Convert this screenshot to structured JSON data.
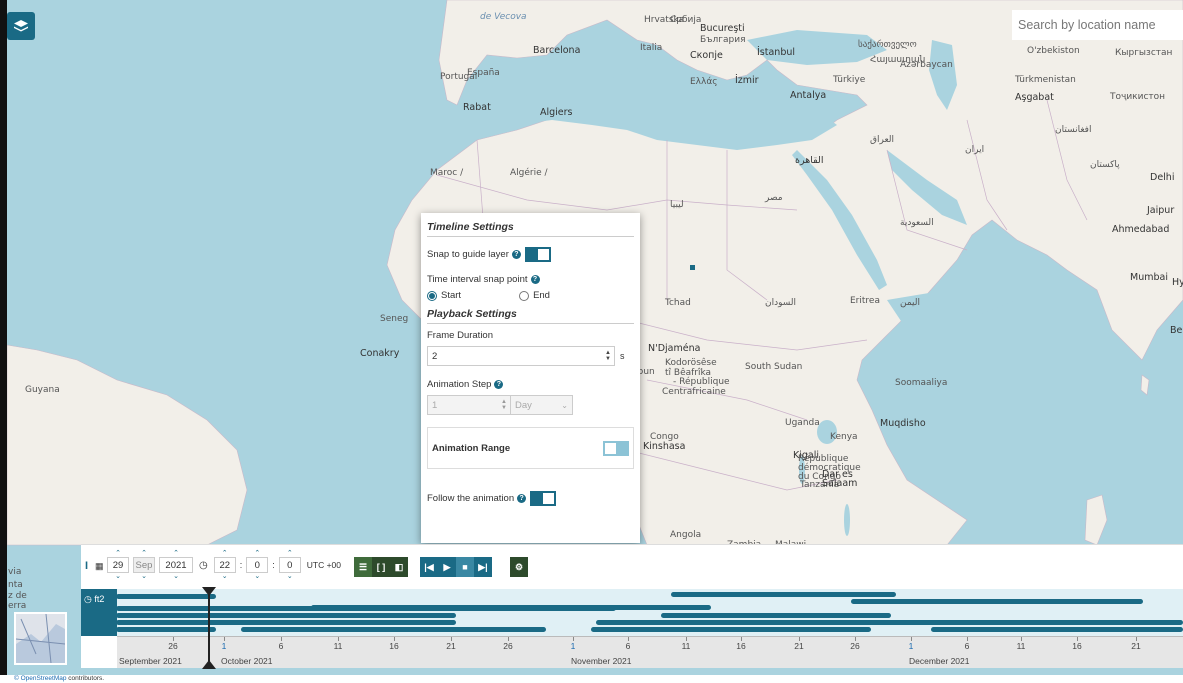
{
  "search": {
    "placeholder": "Search by location name"
  },
  "map_labels": [
    {
      "text": "Barcelona",
      "cls": "dark"
    },
    {
      "text": "España",
      "cls": ""
    },
    {
      "text": "Portugal",
      "cls": ""
    },
    {
      "text": "Italia",
      "cls": ""
    },
    {
      "text": "Hrvatska",
      "cls": ""
    },
    {
      "text": "Србија",
      "cls": ""
    },
    {
      "text": "Bucureşti",
      "cls": "dark"
    },
    {
      "text": "България",
      "cls": ""
    },
    {
      "text": "Скопje",
      "cls": "dark"
    },
    {
      "text": "İstanbul",
      "cls": "dark"
    },
    {
      "text": "Ελλάς",
      "cls": ""
    },
    {
      "text": "İzmir",
      "cls": "dark"
    },
    {
      "text": "Türkiye",
      "cls": ""
    },
    {
      "text": "Antalya",
      "cls": "dark"
    },
    {
      "text": "საქართველო",
      "cls": ""
    },
    {
      "text": "Հայաստան",
      "cls": ""
    },
    {
      "text": "Azərbaycan",
      "cls": ""
    },
    {
      "text": "O'zbekiston",
      "cls": ""
    },
    {
      "text": "Кыргызстан",
      "cls": ""
    },
    {
      "text": "Türkmenistan",
      "cls": ""
    },
    {
      "text": "Aşgabat",
      "cls": "dark"
    },
    {
      "text": "Тоҷикистон",
      "cls": ""
    },
    {
      "text": "Rabat",
      "cls": "dark"
    },
    {
      "text": "Algiers",
      "cls": "dark"
    },
    {
      "text": "Maroc /",
      "cls": ""
    },
    {
      "text": "Algérie /",
      "cls": ""
    },
    {
      "text": "ليبيا",
      "cls": ""
    },
    {
      "text": "مصر",
      "cls": ""
    },
    {
      "text": "القاهرة",
      "cls": "dark"
    },
    {
      "text": "العراق",
      "cls": ""
    },
    {
      "text": "ایران",
      "cls": ""
    },
    {
      "text": "افغانستان",
      "cls": ""
    },
    {
      "text": "پاکستان",
      "cls": ""
    },
    {
      "text": "Delhi",
      "cls": "dark"
    },
    {
      "text": "Jaipur",
      "cls": "dark"
    },
    {
      "text": "السعودية",
      "cls": ""
    },
    {
      "text": "Ahmedabad",
      "cls": "dark"
    },
    {
      "text": "Mumbai",
      "cls": "dark"
    },
    {
      "text": "Hyde",
      "cls": "dark"
    },
    {
      "text": "Benga",
      "cls": "dark"
    },
    {
      "text": "Tchad",
      "cls": ""
    },
    {
      "text": "السودان",
      "cls": ""
    },
    {
      "text": "Eritrea",
      "cls": ""
    },
    {
      "text": "اليمن",
      "cls": ""
    },
    {
      "text": "N'Djaména",
      "cls": "dark"
    },
    {
      "text": "Kodorösêse",
      "cls": ""
    },
    {
      "text": "tî Bêafrîka",
      "cls": ""
    },
    {
      "text": "- République",
      "cls": ""
    },
    {
      "text": "Centrafricaine",
      "cls": ""
    },
    {
      "text": "South Sudan",
      "cls": ""
    },
    {
      "text": "Soomaaliya",
      "cls": ""
    },
    {
      "text": "Muqdisho",
      "cls": "dark"
    },
    {
      "text": "Kenya",
      "cls": ""
    },
    {
      "text": "Uganda",
      "cls": ""
    },
    {
      "text": "Kigali",
      "cls": "dark"
    },
    {
      "text": "République",
      "cls": ""
    },
    {
      "text": "démocratique",
      "cls": ""
    },
    {
      "text": "du Congo",
      "cls": ""
    },
    {
      "text": "Kinshasa",
      "cls": "dark"
    },
    {
      "text": "Congo",
      "cls": ""
    },
    {
      "text": "Tanzania",
      "cls": ""
    },
    {
      "text": "Dar es",
      "cls": "dark"
    },
    {
      "text": "Salaam",
      "cls": "dark"
    },
    {
      "text": "Angola",
      "cls": ""
    },
    {
      "text": "Zambia",
      "cls": ""
    },
    {
      "text": "Malawi",
      "cls": ""
    },
    {
      "text": "Guyana",
      "cls": ""
    },
    {
      "text": "Conakry",
      "cls": "dark"
    },
    {
      "text": "Seneg",
      "cls": ""
    },
    {
      "text": "meroun",
      "cls": ""
    },
    {
      "text": "via",
      "cls": ""
    },
    {
      "text": "nta",
      "cls": ""
    },
    {
      "text": "z de",
      "cls": ""
    },
    {
      "text": "erra",
      "cls": ""
    },
    {
      "text": "de Vecova",
      "cls": "water"
    }
  ],
  "settings": {
    "timeline_title": "Timeline Settings",
    "snap_label": "Snap to guide layer",
    "snap_on": true,
    "interval_label": "Time interval snap point",
    "start_label": "Start",
    "end_label": "End",
    "selected_snap": "Start",
    "playback_title": "Playback Settings",
    "frame_label": "Frame Duration",
    "frame_value": "2",
    "frame_unit": "s",
    "step_label": "Animation Step",
    "step_value": "1",
    "step_unit": "Day",
    "range_label": "Animation Range",
    "range_on": false,
    "follow_label": "Follow the animation",
    "follow_on": true
  },
  "datetime": {
    "day": "29",
    "month": "Sep",
    "year": "2021",
    "hour": "22",
    "minute": "0",
    "second": "0",
    "tz": "UTC +00"
  },
  "timeline": {
    "layer_name": "ft2",
    "day_ticks": [
      "26",
      "1",
      "6",
      "11",
      "16",
      "21",
      "26",
      "1",
      "6",
      "11",
      "16",
      "21",
      "26",
      "1",
      "6",
      "11",
      "16",
      "21"
    ],
    "months": [
      "September 2021",
      "October 2021",
      "November 2021",
      "December 2021"
    ]
  },
  "footer": {
    "link": "© OpenStreetMap",
    "text": "contributors."
  },
  "colors": {
    "accent": "#1a6a85",
    "dark_green": "#2d4a2b",
    "sea": "#aad3df",
    "land": "#f2efe9"
  }
}
